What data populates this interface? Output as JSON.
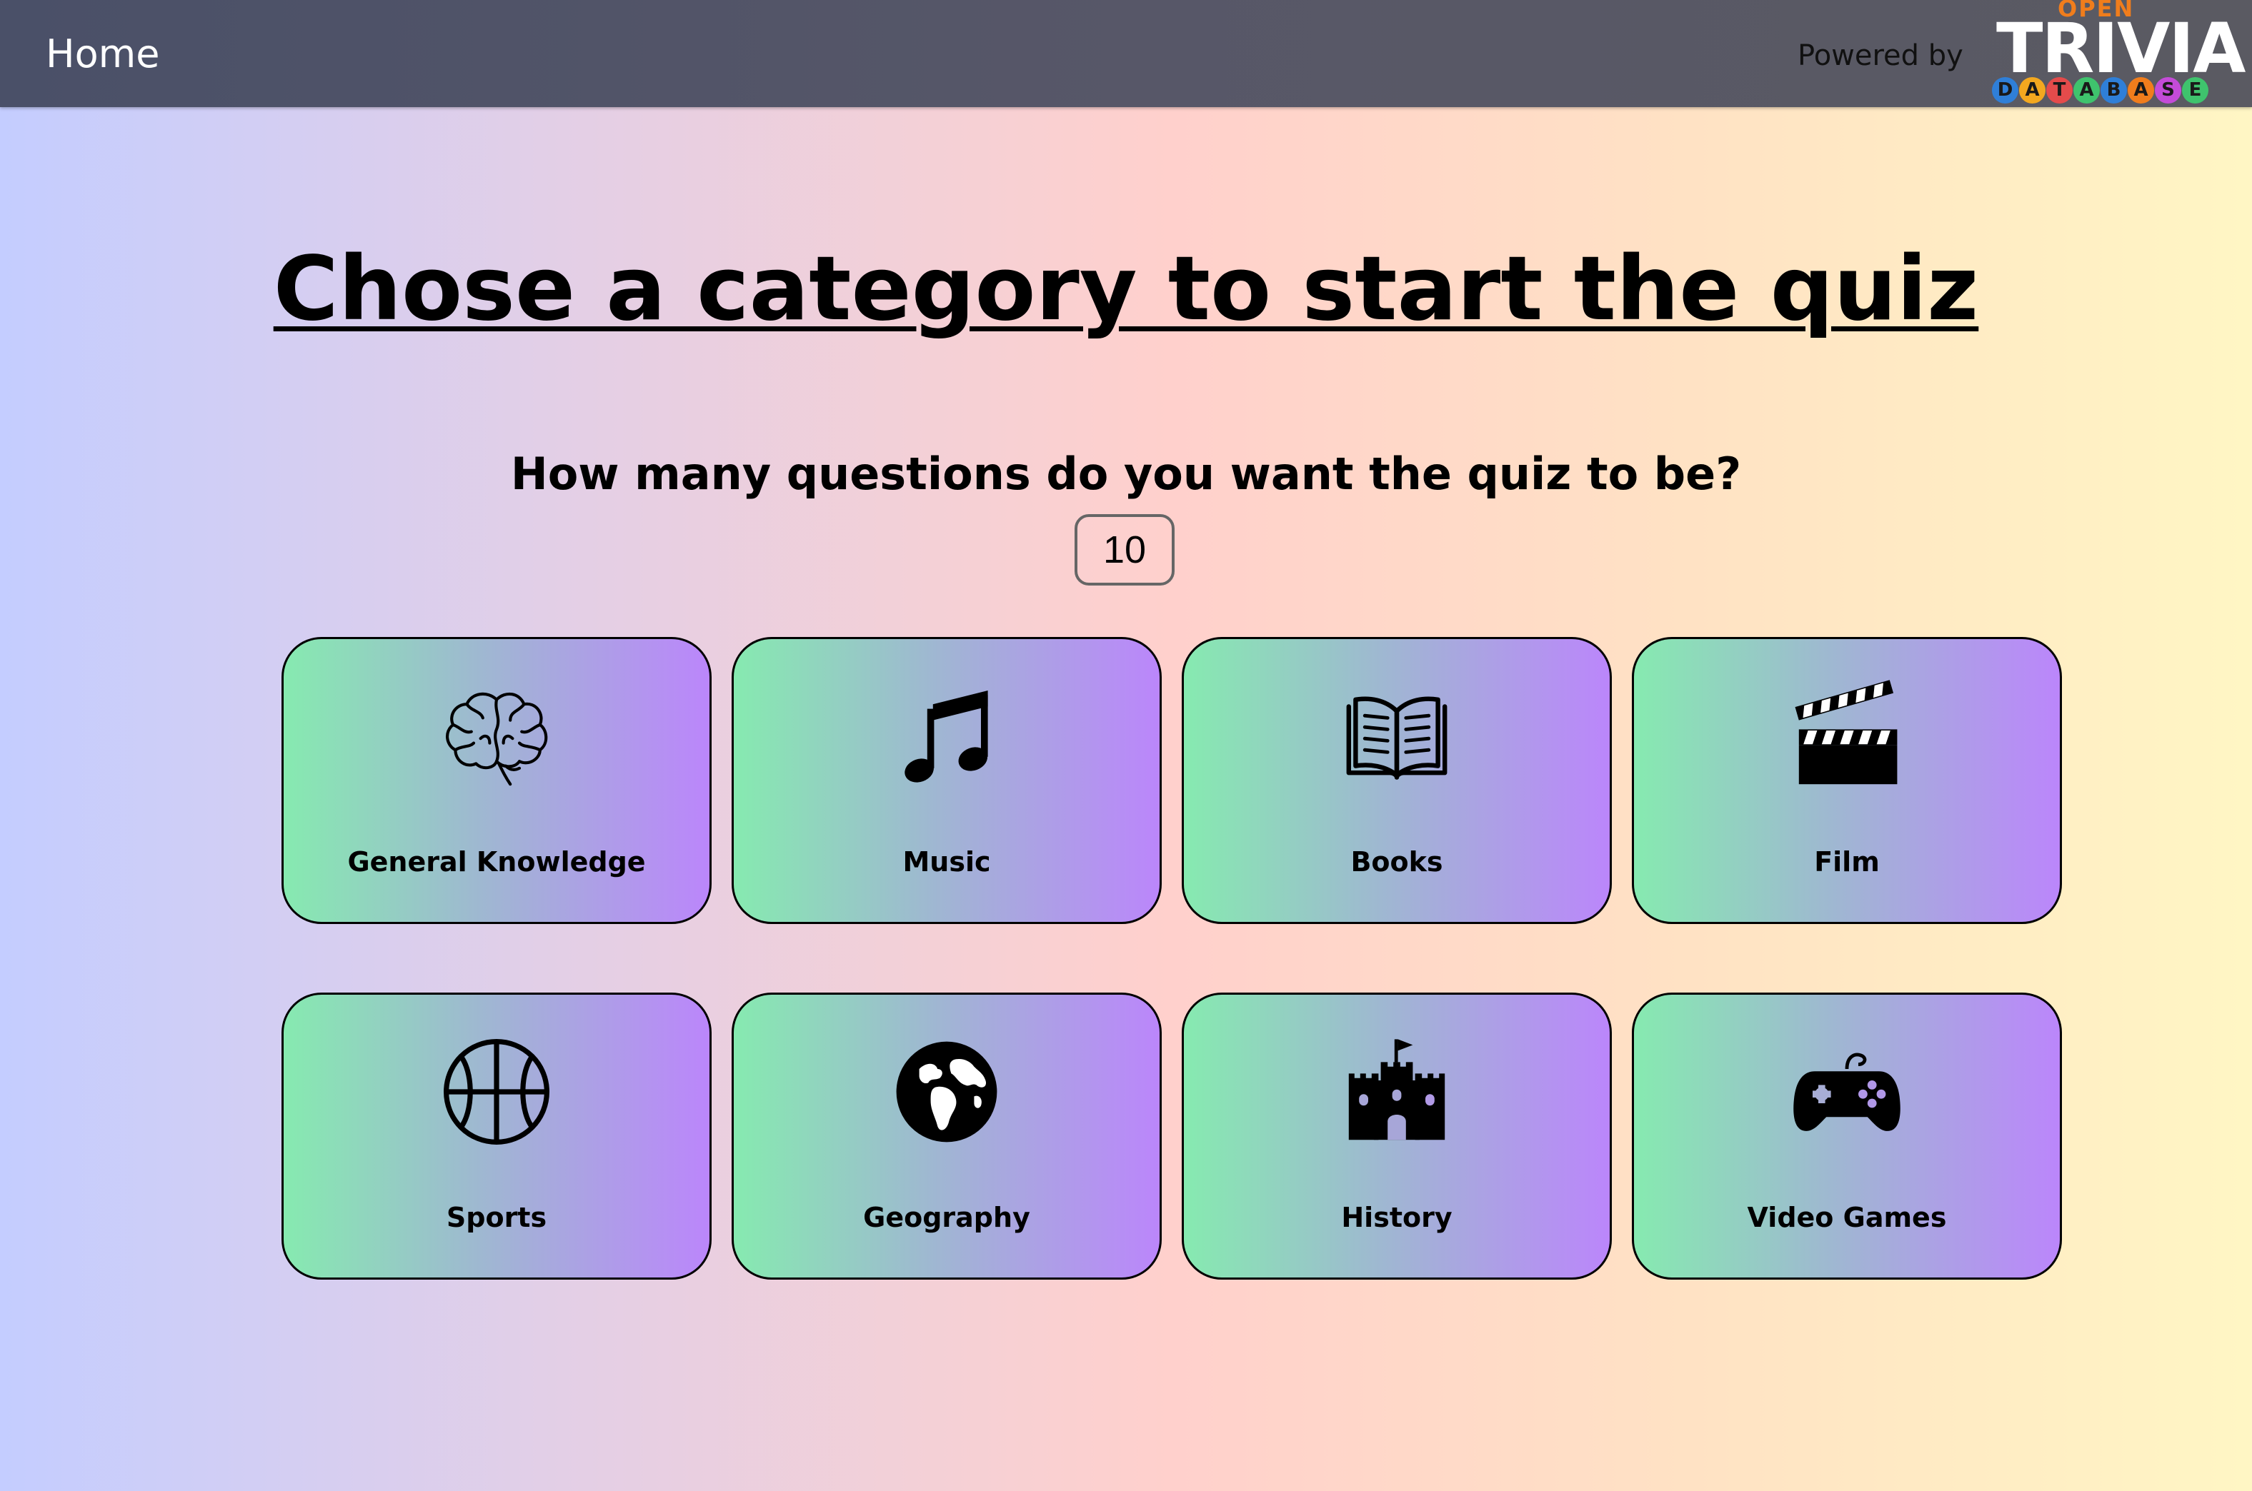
{
  "nav": {
    "home_label": "Home",
    "powered_by": "Powered by",
    "logo": {
      "top_word": "OPEN",
      "main_word": "TRIVIA",
      "letters": [
        {
          "char": "D",
          "color": "#2f7fd8"
        },
        {
          "char": "A",
          "color": "#f3a81f"
        },
        {
          "char": "T",
          "color": "#e44b4b"
        },
        {
          "char": "A",
          "color": "#3fc36d"
        },
        {
          "char": "B",
          "color": "#2f7fd8"
        },
        {
          "char": "A",
          "color": "#f07d1c"
        },
        {
          "char": "S",
          "color": "#c44bd8"
        },
        {
          "char": "E",
          "color": "#3fc36d"
        }
      ]
    }
  },
  "main": {
    "title": "Chose a category to start the quiz",
    "question_label": "How many questions do you want the quiz to be?",
    "question_count": "10"
  },
  "categories": [
    {
      "label": "General Knowledge",
      "icon": "brain-icon"
    },
    {
      "label": "Music",
      "icon": "music-note-icon"
    },
    {
      "label": "Books",
      "icon": "open-book-icon"
    },
    {
      "label": "Film",
      "icon": "clapperboard-icon"
    },
    {
      "label": "Sports",
      "icon": "basketball-icon"
    },
    {
      "label": "Geography",
      "icon": "globe-icon"
    },
    {
      "label": "History",
      "icon": "castle-icon"
    },
    {
      "label": "Video Games",
      "icon": "gamepad-icon"
    }
  ],
  "colors": {
    "card_gradient_start": "#86eab0",
    "card_gradient_end": "#bb86fb",
    "nav_background": "#4f5268"
  }
}
